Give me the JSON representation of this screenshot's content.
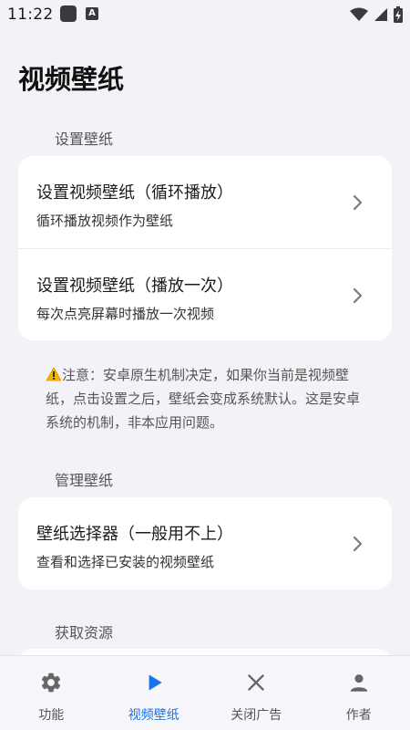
{
  "status_bar": {
    "time": "11:22",
    "a_badge": "A"
  },
  "page": {
    "title": "视频壁纸"
  },
  "sections": [
    {
      "header": "设置壁纸",
      "items": [
        {
          "title": "设置视频壁纸（循环播放）",
          "subtitle": "循环播放视频作为壁纸"
        },
        {
          "title": "设置视频壁纸（播放一次）",
          "subtitle": "每次点亮屏幕时播放一次视频"
        }
      ]
    },
    {
      "header": "管理壁纸",
      "items": [
        {
          "title": "壁纸选择器（一般用不上）",
          "subtitle": "查看和选择已安装的视频壁纸"
        }
      ]
    },
    {
      "header": "获取资源",
      "items": []
    }
  ],
  "note": {
    "text": "注意：安卓原生机制决定，如果你当前是视频壁纸，点击设置之后，壁纸会变成系统默认。这是安卓系统的机制，非本应用问题。"
  },
  "bottom_nav": {
    "active": "video-wallpaper",
    "items": [
      {
        "label": "功能",
        "icon": "gear-icon"
      },
      {
        "label": "视频壁纸",
        "icon": "play-icon"
      },
      {
        "label": "关闭广告",
        "icon": "close-icon"
      },
      {
        "label": "作者",
        "icon": "person-icon"
      }
    ]
  },
  "colors": {
    "accent": "#1a73e8",
    "background": "#f3f2f7",
    "card": "#ffffff",
    "warning": "#f5b400"
  }
}
